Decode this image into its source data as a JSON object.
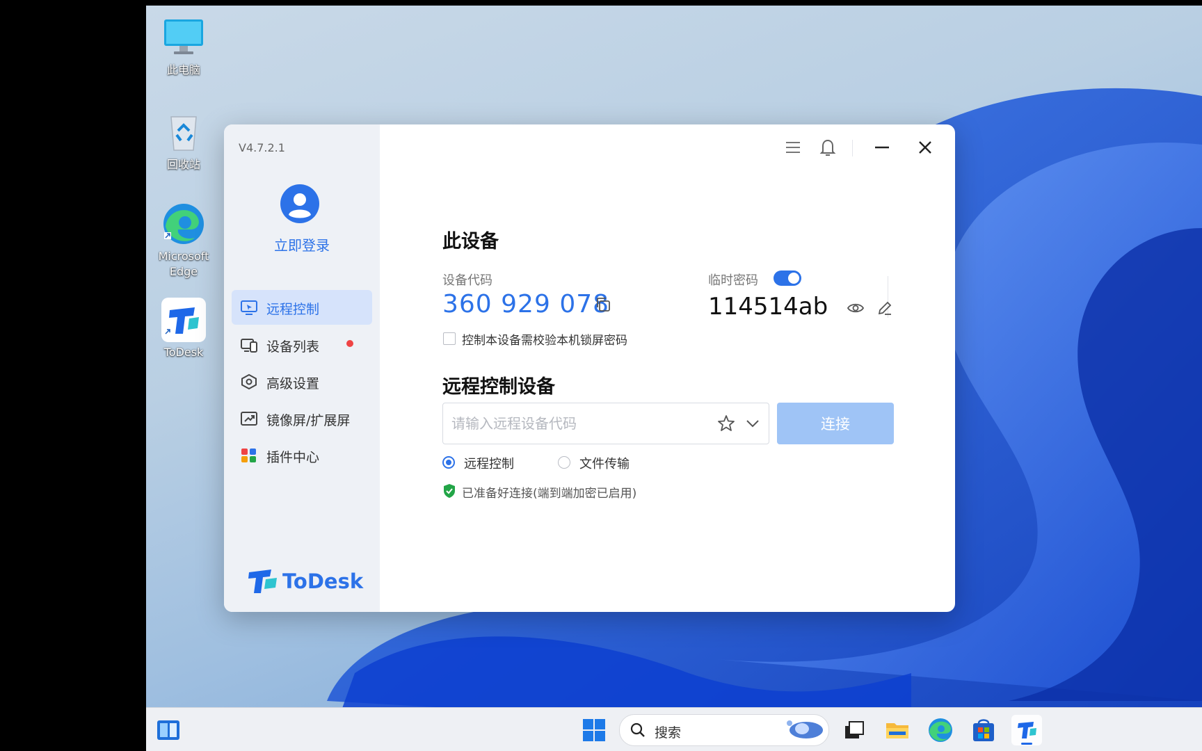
{
  "desktop": {
    "icons": [
      {
        "label": "此电脑"
      },
      {
        "label": "回收站"
      },
      {
        "label": "Microsoft Edge"
      },
      {
        "label": "ToDesk"
      }
    ]
  },
  "app": {
    "version": "V4.7.2.1",
    "login_label": "立即登录",
    "nav": [
      {
        "label": "远程控制",
        "active": true
      },
      {
        "label": "设备列表",
        "badge": true
      },
      {
        "label": "高级设置"
      },
      {
        "label": "镜像屏/扩展屏"
      },
      {
        "label": "插件中心"
      }
    ],
    "brand": "ToDesk",
    "this_device": {
      "heading": "此设备",
      "device_code_label": "设备代码",
      "device_code": "360 929 078",
      "temp_password_label": "临时密码",
      "temp_password": "114514ab",
      "temp_password_enabled": true,
      "lock_check_label": "控制本设备需校验本机锁屏密码",
      "lock_check_checked": false
    },
    "remote": {
      "heading": "远程控制设备",
      "input_placeholder": "请输入远程设备代码",
      "input_value": "",
      "connect_label": "连接",
      "mode_options": [
        "远程控制",
        "文件传输"
      ],
      "mode_selected": "远程控制",
      "status": "已准备好连接(端到端加密已启用)"
    }
  },
  "taskbar": {
    "search_label": "搜索"
  },
  "colors": {
    "accent": "#2c72e8",
    "connect_disabled": "#9fc4f6",
    "badge": "#ef4444",
    "success": "#22a547"
  }
}
